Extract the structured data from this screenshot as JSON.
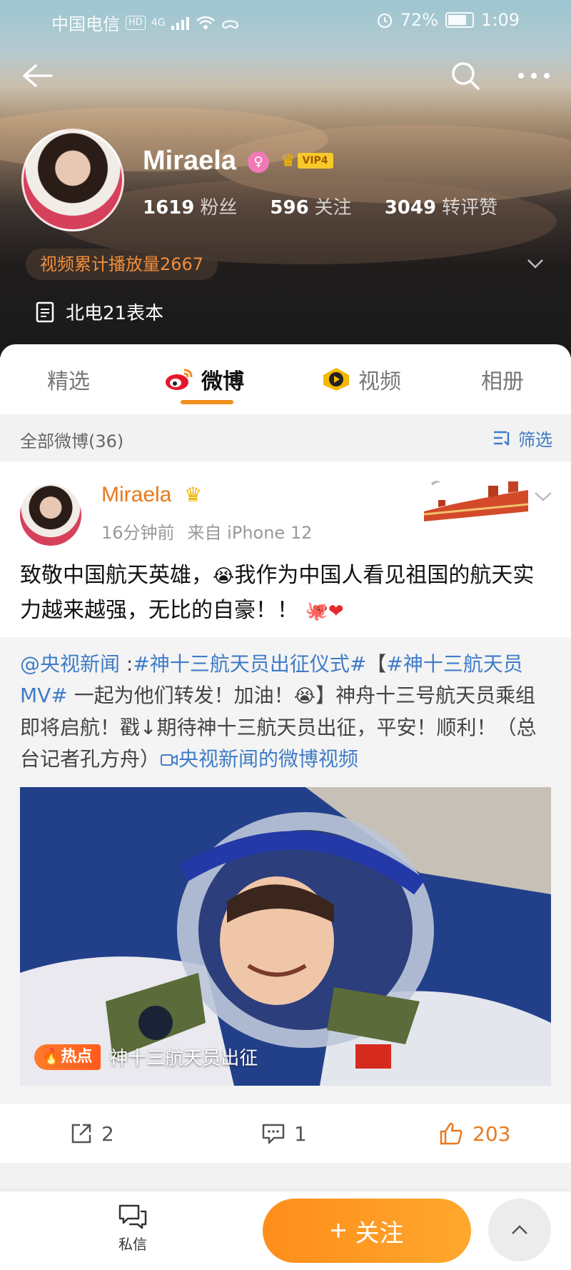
{
  "status_bar": {
    "carrier": "中国电信",
    "hd": "HD",
    "network": "4G",
    "battery_percent": "72%",
    "time": "1:09"
  },
  "nav": {
    "back_icon": "arrow-left-icon",
    "search_icon": "search-icon",
    "more_icon": "more-horizontal-icon"
  },
  "profile": {
    "name": "Miraela",
    "gender_icon": "female-icon",
    "vip_label": "VIP4",
    "stats": [
      {
        "value": "1619",
        "label": "粉丝"
      },
      {
        "value": "596",
        "label": "关注"
      },
      {
        "value": "3049",
        "label": "转评赞"
      }
    ],
    "play_count_label": "视频累计播放量2667",
    "bio": "北电21表本"
  },
  "tabs": [
    {
      "label": "精选",
      "active": false
    },
    {
      "label": "微博",
      "active": true
    },
    {
      "label": "视频",
      "active": false
    },
    {
      "label": "相册",
      "active": false
    }
  ],
  "filter": {
    "count_label": "全部微博(36)",
    "filter_label": "筛选"
  },
  "post": {
    "author": "Miraela",
    "time": "16分钟前",
    "source": "来自 iPhone 12",
    "text_part1": "致敬中国航天英雄，",
    "text_part2": "我作为中国人看见祖国的航天实力越来越强，无比的自豪！！",
    "repost": {
      "mention": "@央视新闻",
      "sep": " :",
      "topic1": "#神十三航天员出征仪式#",
      "bracket_open": "【",
      "topic2": "#神十三航天员MV#",
      "text1": " 一起为他们转发！加油！",
      "text2": "】神舟十三号航天员乘组即将启航！戳↓期待神十三航天员出征，平安！顺利！（总台记者孔方舟）",
      "video_link": "央视新闻的微博视频",
      "hot_label": "热点",
      "hot_title": "神十三航天员出征"
    },
    "actions": {
      "repost_count": "2",
      "comment_count": "1",
      "like_count": "203"
    }
  },
  "bottom": {
    "dm_label": "私信",
    "follow_label": "关注"
  },
  "colors": {
    "accent_orange": "#f08e1e",
    "link_blue": "#3f7cc8",
    "author_orange": "#e8791d"
  }
}
